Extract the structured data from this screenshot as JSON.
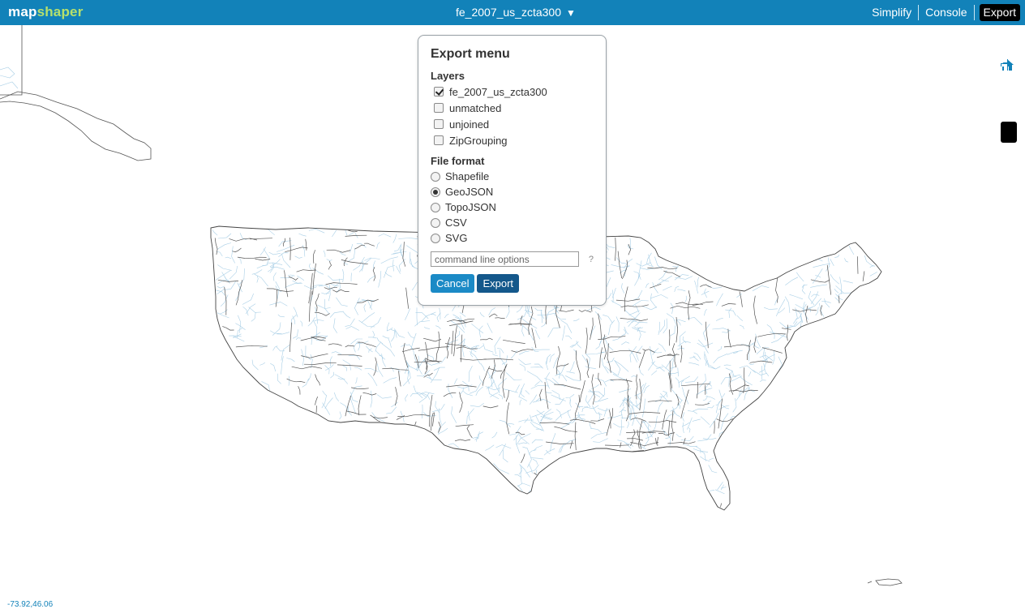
{
  "app": {
    "logo_part1": "map",
    "logo_part2": "shaper",
    "layer_name": "fe_2007_us_zcta300",
    "layer_caret": "▼"
  },
  "nav": {
    "simplify": "Simplify",
    "console": "Console",
    "export": "Export"
  },
  "colors": {
    "topbar": "#1282b9",
    "logo_accent": "#b6e06c",
    "boundary": "#555555",
    "zip_lines": "#a9cfe6"
  },
  "map_buttons": [
    "home-icon",
    "zoom-in-icon",
    "zoom-out-icon",
    "info-icon"
  ],
  "coords": "-73.92,46.06",
  "export_menu": {
    "title": "Export menu",
    "layers_title": "Layers",
    "layers": [
      {
        "label": "fe_2007_us_zcta300",
        "checked": true
      },
      {
        "label": "unmatched",
        "checked": false
      },
      {
        "label": "unjoined",
        "checked": false
      },
      {
        "label": "ZipGrouping",
        "checked": false
      }
    ],
    "format_title": "File format",
    "formats": [
      {
        "label": "Shapefile",
        "selected": false
      },
      {
        "label": "GeoJSON",
        "selected": true
      },
      {
        "label": "TopoJSON",
        "selected": false
      },
      {
        "label": "CSV",
        "selected": false
      },
      {
        "label": "SVG",
        "selected": false
      }
    ],
    "options_placeholder": "command line options",
    "help": "?",
    "cancel": "Cancel",
    "export": "Export"
  }
}
